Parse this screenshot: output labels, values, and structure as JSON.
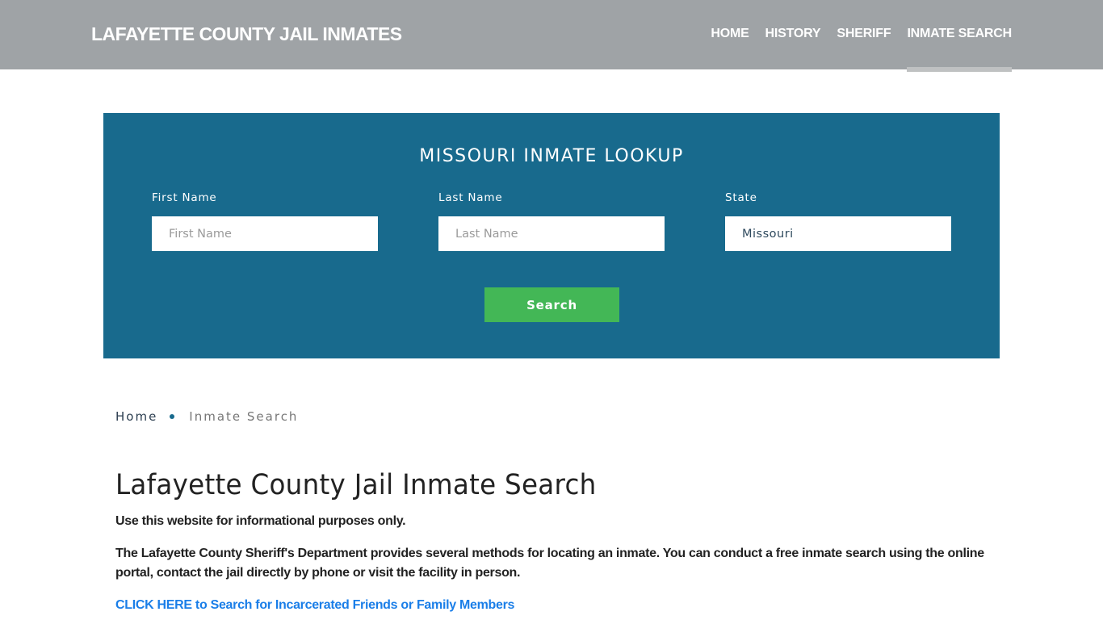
{
  "header": {
    "brand": "LAFAYETTE COUNTY JAIL INMATES",
    "nav": [
      {
        "label": "HOME",
        "active": false
      },
      {
        "label": "HISTORY",
        "active": false
      },
      {
        "label": "SHERIFF",
        "active": false
      },
      {
        "label": "INMATE SEARCH",
        "active": true
      }
    ]
  },
  "lookup": {
    "title": "MISSOURI INMATE LOOKUP",
    "fields": {
      "first_name": {
        "label": "First Name",
        "placeholder": "First Name",
        "value": ""
      },
      "last_name": {
        "label": "Last Name",
        "placeholder": "Last Name",
        "value": ""
      },
      "state": {
        "label": "State",
        "value": "Missouri"
      }
    },
    "search_label": "Search"
  },
  "breadcrumb": {
    "home": "Home",
    "current": "Inmate Search"
  },
  "content": {
    "title": "Lafayette County Jail Inmate Search",
    "paragraphs": [
      "Use this website for informational purposes only.",
      "The Lafayette County Sheriff's Department provides several methods for locating an inmate. You can conduct a free inmate search using the online portal, contact the jail directly by phone or visit the facility in person."
    ],
    "cta_link": "CLICK HERE to Search for Incarcerated Friends or Family Members"
  },
  "colors": {
    "header_bg": "#9fa3a6",
    "lookup_bg": "#186a8d",
    "search_button": "#43b756",
    "link": "#1a7ee8"
  }
}
